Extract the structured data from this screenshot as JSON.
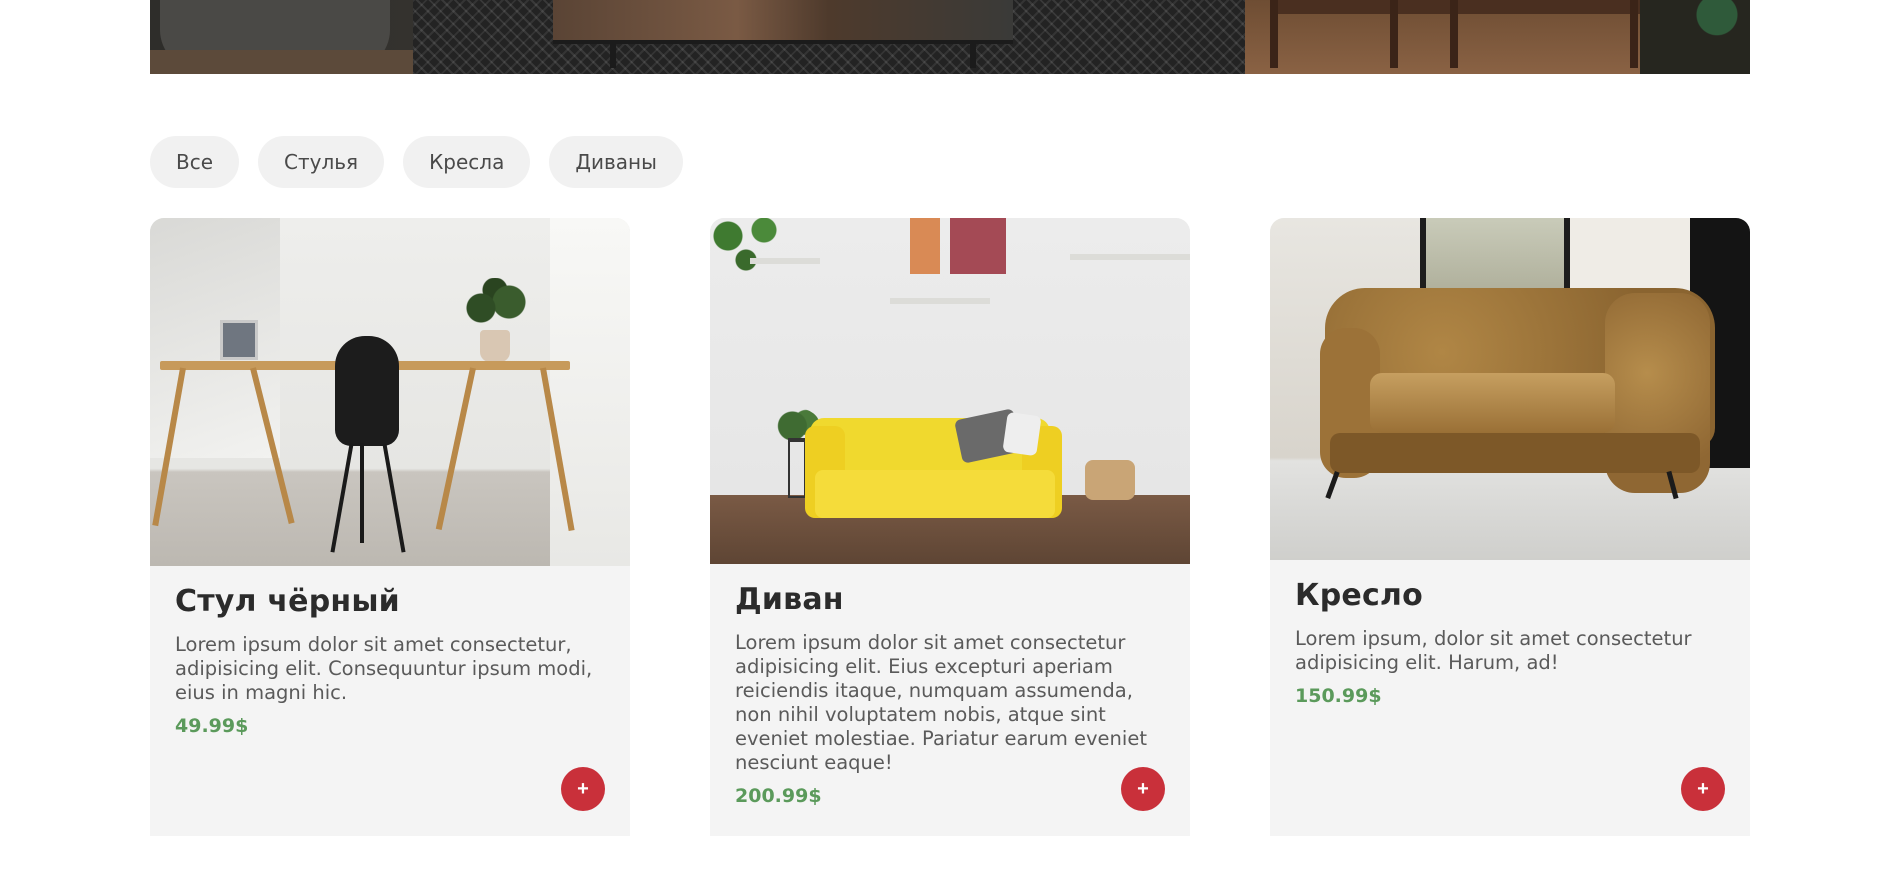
{
  "filters": {
    "items": [
      "Все",
      "Стулья",
      "Кресла",
      "Диваны"
    ]
  },
  "products": [
    {
      "title": "Стул чёрный",
      "description": "Lorem ipsum dolor sit amet consectetur, adipisicing elit. Consequuntur ipsum modi, eius in magni hic.",
      "price": "49.99$",
      "add_label": "+"
    },
    {
      "title": "Диван",
      "description": "Lorem ipsum dolor sit amet consectetur adipisicing elit. Eius excepturi aperiam reiciendis itaque, numquam assumenda, non nihil voluptatem nobis, atque sint eveniet molestiae. Pariatur earum eveniet nesciunt eaque!",
      "price": "200.99$",
      "add_label": "+"
    },
    {
      "title": "Кресло",
      "description": "Lorem ipsum, dolor sit amet consectetur adipisicing elit. Harum, ad!",
      "price": "150.99$",
      "add_label": "+"
    }
  ],
  "colors": {
    "accent": "#c9303a",
    "price": "#5b9a5b",
    "card_bg": "#f4f4f4",
    "pill_bg": "#f1f1f1"
  }
}
